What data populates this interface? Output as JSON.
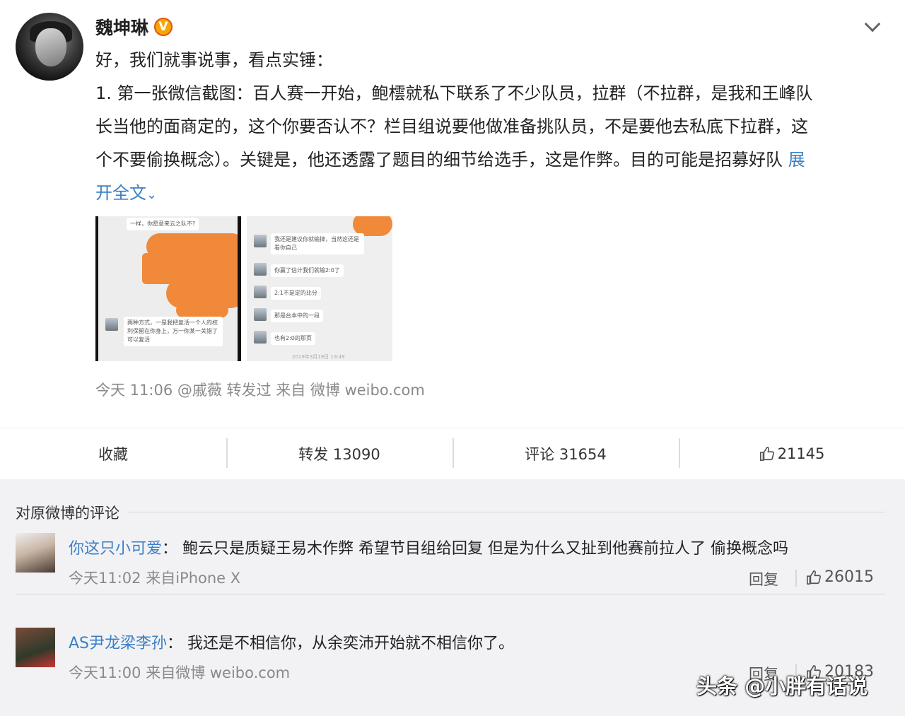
{
  "post": {
    "author": "魏坤琳",
    "verified_badge": "V",
    "lines": [
      "好，我们就事说事，看点实锤：",
      "1. 第一张微信截图：百人赛一开始，鲍橒就私下联系了不少队员，拉群（不拉群，是我和王峰队",
      "长当他的面商定的，这个你要否认不？栏目组说要他做准备挑队员，不是要他去私底下拉群，这",
      "个不要偷换概念）。关键是，他还透露了题目的细节给选手，这是作弊。目的可能是招募好队"
    ],
    "expand_inline": "展",
    "expand_label": "开全文",
    "meta": "今天 11:06 @戚薇 转发过 来自 微博 weibo.com",
    "screenshot1": {
      "top_bubble": "一样，你愿意来云之队不?",
      "bottom_bubble": "两种方式，一是我把复活一个人的权利保留在你身上，万一你某一关错了可以复活"
    },
    "screenshot2": {
      "bubbles": [
        "我还是建议你就输掉，当然这还是看你自己",
        "你赢了估计我们就输2:0了",
        "2:1不是定的比分",
        "那是台本中的一段",
        "也有2:0的那页"
      ],
      "timestamp": "2019年3月19日 19:49"
    }
  },
  "actions": {
    "favorite": "收藏",
    "repost": "转发 13090",
    "comment": "评论 31654",
    "like_count": "21145"
  },
  "comments": {
    "title": "对原微博的评论",
    "items": [
      {
        "user": "你这只小可爱",
        "text": "：  鲍云只是质疑王易木作弊 希望节目组给回复 但是为什么又扯到他赛前拉人了 偷换概念吗",
        "meta": "今天11:02 来自iPhone X",
        "reply": "回复",
        "likes": "26015"
      },
      {
        "user": "AS尹龙梁李孙",
        "text": "：  我还是不相信你，从余奕沛开始就不相信你了。",
        "meta": "今天11:00 来自微博 weibo.com",
        "reply": "回复",
        "likes": "20183"
      }
    ]
  },
  "watermark": "头条 @小胖有话说",
  "icons": {
    "chevron": "chevron-down-icon",
    "like": "thumbs-up-icon",
    "verified": "verified-badge-icon"
  },
  "colors": {
    "link": "#3b7fc4",
    "verified": "#f7a500",
    "comments_bg": "#f2f2f5"
  }
}
